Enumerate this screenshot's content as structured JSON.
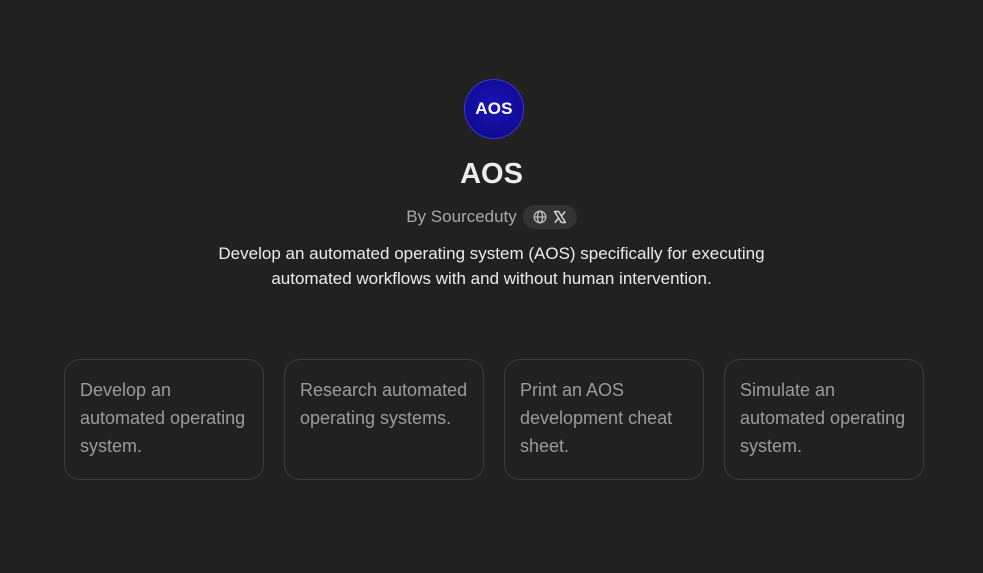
{
  "gpt": {
    "avatar_text": "AOS",
    "avatar_color": "#120c9a",
    "name": "AOS",
    "author": "By Sourceduty",
    "social_icons": [
      "globe-icon",
      "x-logo-icon"
    ],
    "description": "Develop an automated operating system (AOS) specifically for executing automated workflows with and without human intervention."
  },
  "starters": [
    {
      "label": "Develop an automated operating system."
    },
    {
      "label": "Research automated operating systems."
    },
    {
      "label": "Print an AOS development cheat sheet."
    },
    {
      "label": "Simulate an automated operating system."
    }
  ],
  "colors": {
    "background": "#212121",
    "title": "#ececec",
    "muted": "#9b9b9b",
    "card_border": "#3c3c3c"
  }
}
